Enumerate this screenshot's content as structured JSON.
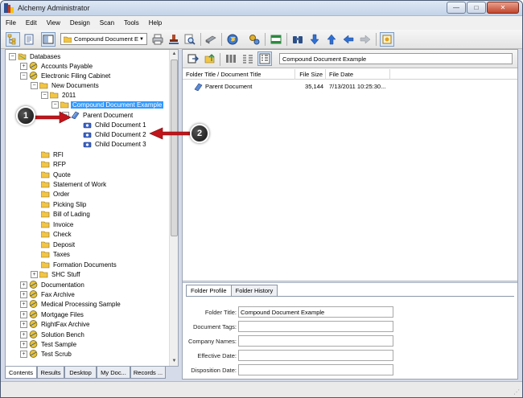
{
  "window": {
    "title": "Alchemy Administrator"
  },
  "menu": [
    "File",
    "Edit",
    "View",
    "Design",
    "Scan",
    "Tools",
    "Help"
  ],
  "toolbar": {
    "database_combo": "Compound Document E"
  },
  "tree": {
    "root": "Databases",
    "items": [
      "Accounts Payable",
      "Electronic Filing Cabinet",
      "New Documents",
      "2011",
      "Compound Document Example",
      "Parent Document",
      "Child Document 1",
      "Child Document 2",
      "Child Document 3",
      "RFI",
      "RFP",
      "Quote",
      "Statement of Work",
      "Order",
      "Picking Slip",
      "Bill of Lading",
      "Invoice",
      "Check",
      "Deposit",
      "Taxes",
      "Formation Documents",
      "SHC Stuff",
      "Documentation",
      "Fax Archive",
      "Medical Processing Sample",
      "Mortgage Files",
      "RightFax Archive",
      "Solution Bench",
      "Test Sample",
      "Test Scrub"
    ]
  },
  "bottom_tabs": [
    "Contents",
    "Results",
    "Desktop",
    "My Doc...",
    "Records ..."
  ],
  "right": {
    "path": "Compound Document Example",
    "columns": [
      "Folder Title / Document Title",
      "File Size",
      "File Date"
    ],
    "rows": [
      {
        "title": "Parent Document",
        "size": "35,144",
        "date": "7/13/2011 10:25:30..."
      }
    ]
  },
  "profile": {
    "tabs": [
      "Folder Profile",
      "Folder History"
    ],
    "fields": [
      {
        "label": "Folder Title:",
        "value": "Compound Document Example"
      },
      {
        "label": "Document Tags:",
        "value": ""
      },
      {
        "label": "Company Names:",
        "value": ""
      },
      {
        "label": "Effective Date:",
        "value": ""
      },
      {
        "label": "Disposition Date:",
        "value": ""
      }
    ]
  },
  "callouts": [
    "1",
    "2"
  ],
  "colors": {
    "selection": "#3399ff",
    "arrow": "#c0151b",
    "folder": "#f2c545"
  }
}
